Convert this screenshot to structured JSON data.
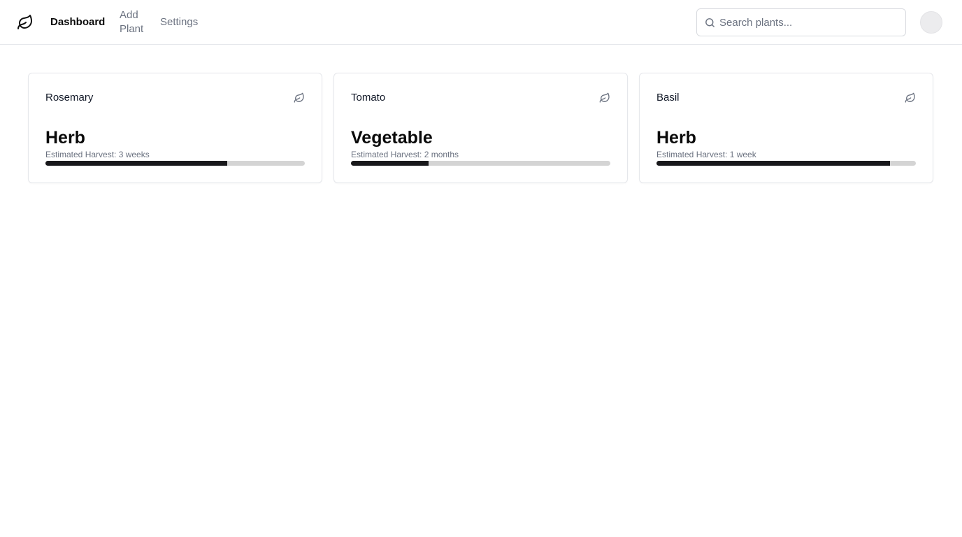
{
  "nav": {
    "logo_icon": "leaf-icon",
    "links": [
      {
        "label": "Dashboard",
        "active": true
      },
      {
        "label": "Add Plant",
        "active": false
      },
      {
        "label": "Settings",
        "active": false
      }
    ]
  },
  "search": {
    "placeholder": "Search plants...",
    "value": "",
    "icon": "search-icon"
  },
  "plants": [
    {
      "name": "Rosemary",
      "category": "Herb",
      "harvest": "Estimated Harvest: 3 weeks",
      "progress": 0.7,
      "icon": "leaf-icon"
    },
    {
      "name": "Tomato",
      "category": "Vegetable",
      "harvest": "Estimated Harvest: 2 months",
      "progress": 0.3,
      "icon": "leaf-icon"
    },
    {
      "name": "Basil",
      "category": "Herb",
      "harvest": "Estimated Harvest: 1 week",
      "progress": 0.9,
      "icon": "leaf-icon"
    }
  ],
  "colors": {
    "progress_fill": "#18181b",
    "progress_track": "#d4d4d4",
    "border": "#e5e7eb",
    "muted_text": "#6b7280"
  }
}
